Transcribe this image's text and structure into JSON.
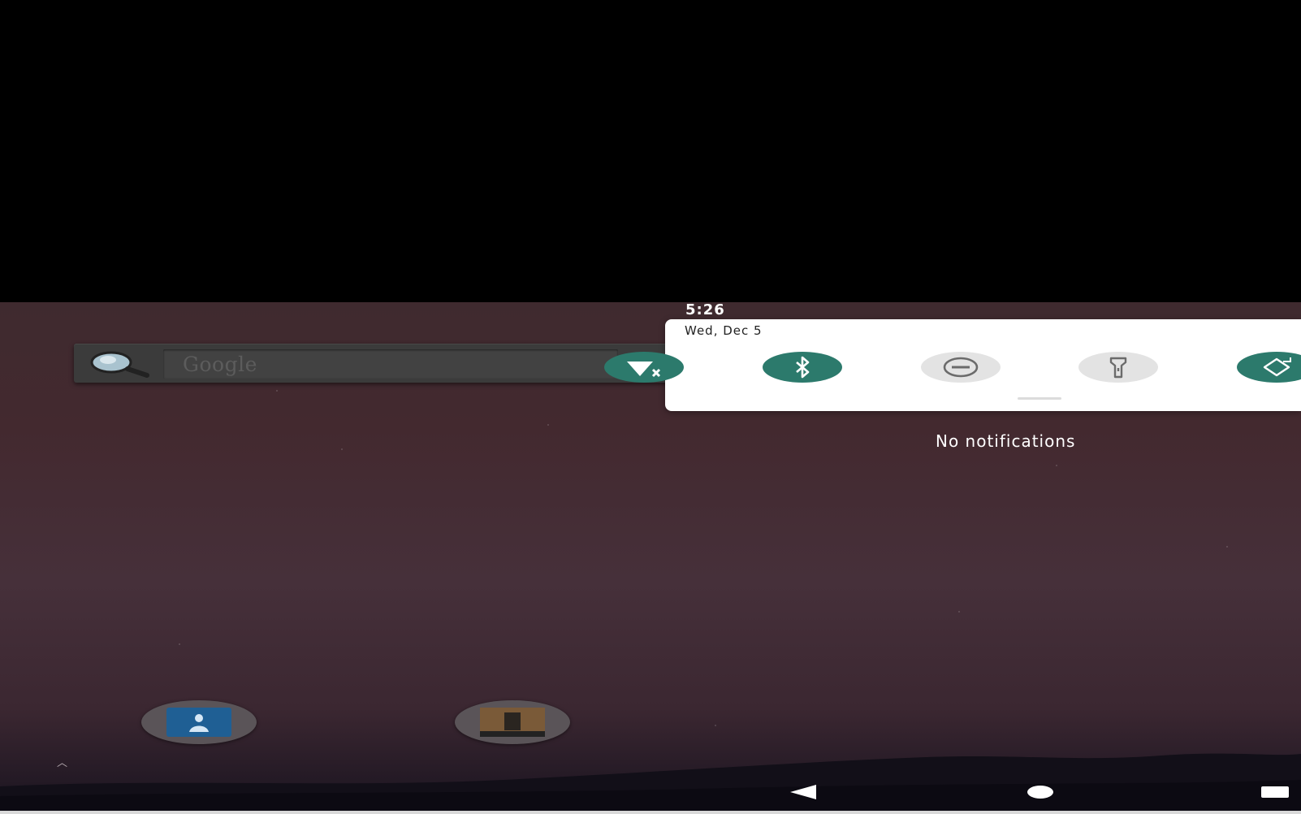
{
  "status": {
    "time": "5:26"
  },
  "quick_settings": {
    "date": "Wed, Dec 5",
    "tiles": [
      {
        "icon": "wifi-off-icon",
        "state": "on"
      },
      {
        "icon": "bluetooth-icon",
        "state": "on"
      },
      {
        "icon": "do-not-disturb-icon",
        "state": "off"
      },
      {
        "icon": "flashlight-icon",
        "state": "off"
      },
      {
        "icon": "auto-rotate-icon",
        "state": "on"
      }
    ],
    "accent_color": "#2c7a6c"
  },
  "notifications": {
    "empty_text": "No notifications"
  },
  "search_widget": {
    "brand_text": "Google"
  },
  "dock": {
    "apps": [
      "contacts",
      "game"
    ]
  }
}
